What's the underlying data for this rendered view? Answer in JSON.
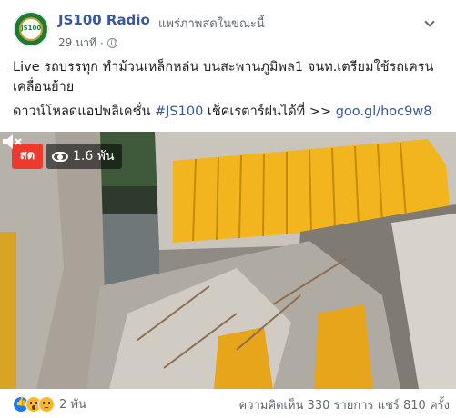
{
  "post": {
    "page_name": "JS100 Radio",
    "live_status": "แพร่ภาพสดในขณะนี้",
    "timestamp": "29 นาที",
    "avatar_text": "JS100",
    "text": "Live รถบรรทุก ทำม้วนเหล็กหล่น บนสะพานภูมิพล1 จนท.เตรียมใช้รถเครน เคลื่อนย้าย",
    "app_line_prefix": "ดาวน์โหลดแอปพลิเคชั่น",
    "hashtag": "#JS100",
    "app_line_middle": "เช็คเรตาร์ฝนได้ที่ >>",
    "link": "goo.gl/hoc9w8"
  },
  "video": {
    "live_label": "สด",
    "viewer_count": "1.6 พัน"
  },
  "footer": {
    "reaction_count": "2 พัน",
    "comments_label": "ความคิดเห็น 330 รายการ",
    "shares_label": "แชร์ 810 ครั้ง"
  },
  "icons": [
    "globe-icon",
    "chevron-down-icon",
    "eye-icon",
    "sound-icon",
    "like-icon",
    "wow-icon",
    "sad-icon"
  ],
  "colors": {
    "link": "#385898",
    "live_red": "#eb3b2f",
    "secondary_text": "#606770"
  }
}
